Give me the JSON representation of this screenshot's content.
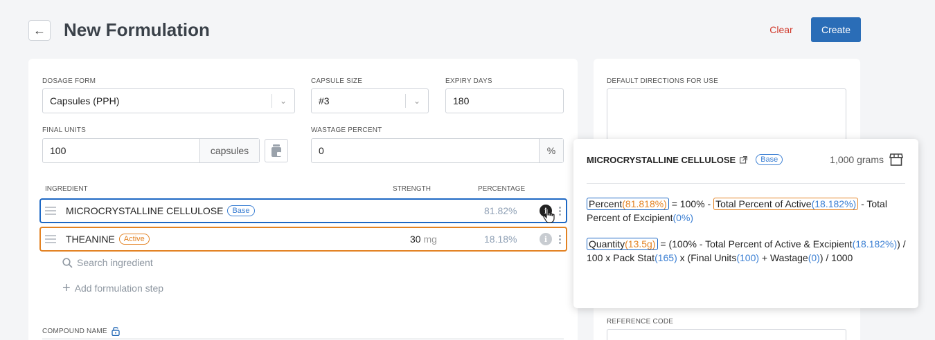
{
  "header": {
    "title": "New Formulation",
    "clear_label": "Clear",
    "create_label": "Create"
  },
  "form": {
    "dosage_form_label": "DOSAGE FORM",
    "dosage_form_value": "Capsules (PPH)",
    "capsule_size_label": "CAPSULE SIZE",
    "capsule_size_value": "#3",
    "expiry_label": "EXPIRY DAYS",
    "expiry_value": "180",
    "final_units_label": "FINAL UNITS",
    "final_units_value": "100",
    "final_units_suffix": "capsules",
    "wastage_label": "WASTAGE PERCENT",
    "wastage_value": "0",
    "wastage_suffix": "%",
    "directions_label": "DEFAULT DIRECTIONS FOR USE",
    "compound_label": "COMPOUND NAME",
    "reference_label": "REFERENCE CODE"
  },
  "ingredients": {
    "col_ingredient": "INGREDIENT",
    "col_strength": "STRENGTH",
    "col_percentage": "PERCENTAGE",
    "rows": [
      {
        "name": "MICROCRYSTALLINE CELLULOSE",
        "badge": "Base",
        "strength": "",
        "unit": "",
        "percentage": "81.82%"
      },
      {
        "name": "THEANINE",
        "badge": "Active",
        "strength": "30",
        "unit": "mg",
        "percentage": "18.18%"
      }
    ],
    "search_placeholder": "Search ingredient",
    "add_step_label": "Add formulation step"
  },
  "popover": {
    "title": "MICROCRYSTALLINE CELLULOSE",
    "badge": "Base",
    "amount": "1,000 grams",
    "f1": {
      "percent_label": "Percent",
      "percent_value": "(81.818%)",
      "eq": "= 100% -",
      "active_label": "Total Percent of Active",
      "active_value": "(18.182%)",
      "rest": "- Total Percent of Excipient",
      "excipient_value": "(0%)"
    },
    "f2": {
      "qty_label": "Quantity",
      "qty_value": "(13.5g)",
      "p1": "= (100% - Total Percent of Active & Excipient",
      "v1": "(18.182%)",
      "p2": ") / 100 x Pack Stat",
      "v2": "(165)",
      "p3": "x (Final Units",
      "v3": "(100)",
      "p4": "+ Wastage",
      "v4": "(0)",
      "p5": ") / 1000"
    }
  },
  "colors": {
    "primary": "#2a6db7",
    "danger": "#d0392b",
    "highlight_blue": "#1e68c4",
    "highlight_orange": "#e38222"
  }
}
